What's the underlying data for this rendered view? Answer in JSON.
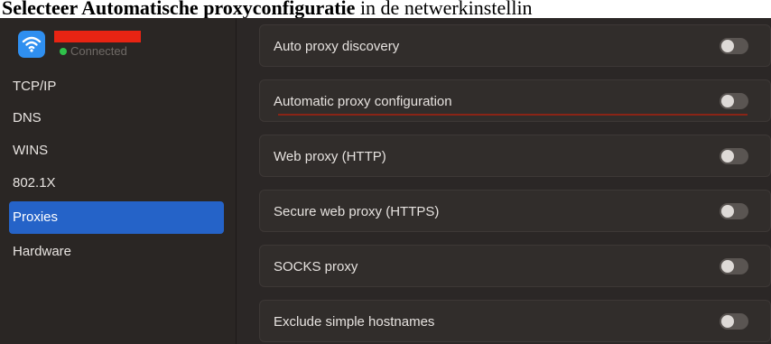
{
  "caption": {
    "bold": "Selecteer Automatische proxyconfiguratie",
    "rest": " in de netwerkinstellin"
  },
  "sidebar": {
    "connection": {
      "status": "Connected",
      "status_color": "#2fc14a",
      "redaction_color": "#e82413",
      "icon": "wifi-icon"
    },
    "items": [
      {
        "label": "TCP/IP",
        "selected": false
      },
      {
        "label": "DNS",
        "selected": false
      },
      {
        "label": "WINS",
        "selected": false
      },
      {
        "label": "802.1X",
        "selected": false
      },
      {
        "label": "Proxies",
        "selected": true
      },
      {
        "label": "Hardware",
        "selected": false
      }
    ]
  },
  "proxies": [
    {
      "label": "Auto proxy discovery",
      "enabled": false
    },
    {
      "label": "Automatic proxy configuration",
      "enabled": false,
      "highlighted": true
    },
    {
      "label": "Web proxy (HTTP)",
      "enabled": false
    },
    {
      "label": "Secure web proxy (HTTPS)",
      "enabled": false
    },
    {
      "label": "SOCKS proxy",
      "enabled": false
    },
    {
      "label": "Exclude simple hostnames",
      "enabled": false
    }
  ],
  "colors": {
    "accent": "#2563c8",
    "highlight_underline": "#8a2416",
    "background": "#2b2726"
  }
}
